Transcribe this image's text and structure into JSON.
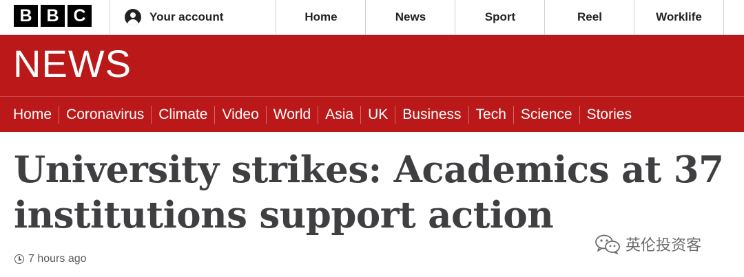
{
  "topbar": {
    "logo_letters": [
      "B",
      "B",
      "C"
    ],
    "account_label": "Your account",
    "nav": [
      "Home",
      "News",
      "Sport",
      "Reel",
      "Worklife"
    ]
  },
  "banner": {
    "wordmark": "NEWS",
    "nav": [
      "Home",
      "Coronavirus",
      "Climate",
      "Video",
      "World",
      "Asia",
      "UK",
      "Business",
      "Tech",
      "Science",
      "Stories"
    ]
  },
  "article": {
    "headline": "University strikes: Academics at 37 institutions support action",
    "timestamp": "7 hours ago"
  },
  "watermark": {
    "text": "英伦投资客"
  },
  "colors": {
    "brand_red": "#bb1919",
    "headline": "#3f3f42"
  }
}
